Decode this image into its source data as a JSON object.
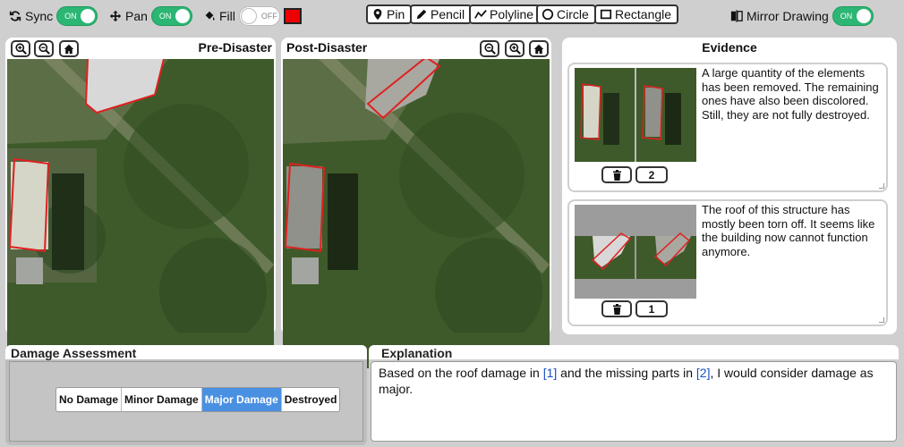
{
  "toolbar": {
    "sync": {
      "label": "Sync",
      "state": "ON"
    },
    "pan": {
      "label": "Pan",
      "state": "ON"
    },
    "fill": {
      "label": "Fill",
      "state": "OFF",
      "color": "#e00000"
    },
    "tools": [
      {
        "label": "Pin",
        "icon": "pin-icon"
      },
      {
        "label": "Pencil",
        "icon": "pencil-icon"
      },
      {
        "label": "Polyline",
        "icon": "polyline-icon"
      },
      {
        "label": "Circle",
        "icon": "circle-icon"
      },
      {
        "label": "Rectangle",
        "icon": "rectangle-icon"
      }
    ],
    "mirror": {
      "label": "Mirror Drawing",
      "state": "ON"
    }
  },
  "pre_panel": {
    "title": "Pre-Disaster"
  },
  "post_panel": {
    "title": "Post-Disaster"
  },
  "evidence": {
    "title": "Evidence",
    "items": [
      {
        "text": "A large quantity of the elements has been removed. The remaining ones have also been discolored. Still, they are not fully destroyed.",
        "number": "2"
      },
      {
        "text": "The roof of this structure has mostly been torn off. It seems like the building now cannot function anymore.",
        "number": "1"
      }
    ]
  },
  "assessment": {
    "title": "Damage Assessment",
    "options": [
      "No Damage",
      "Minor Damage",
      "Major Damage",
      "Destroyed"
    ],
    "selected": "Major Damage"
  },
  "explanation": {
    "title": "Explanation",
    "part1": "Based on the roof damage in ",
    "cite1": "[1]",
    "part2": " and the missing parts in ",
    "cite2": "[2]",
    "part3": ", I would consider damage as major."
  },
  "colors": {
    "accent": "#4a90e2",
    "toggle_on": "#2bb673",
    "annotation": "#e00000"
  }
}
